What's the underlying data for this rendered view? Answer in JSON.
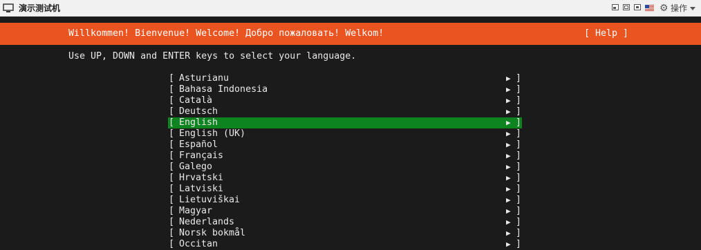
{
  "window": {
    "title": "演示测试机",
    "operations_label": "操作",
    "icons": [
      "monitor-icon",
      "window-mode-icon",
      "window-restore-icon",
      "window-minimize-icon",
      "us-flag-icon",
      "gear-icon",
      "chevron-down-icon"
    ]
  },
  "installer": {
    "header_text": "Willkommen! Bienvenue! Welcome! Добро пожаловать! Welkom!",
    "help_label": "[ Help ]",
    "instruction": "Use UP, DOWN and ENTER keys to select your language.",
    "header_color": "#e95420",
    "selected_color": "#0e8420",
    "languages": [
      {
        "label": "Asturianu",
        "selected": false
      },
      {
        "label": "Bahasa Indonesia",
        "selected": false
      },
      {
        "label": "Català",
        "selected": false
      },
      {
        "label": "Deutsch",
        "selected": false
      },
      {
        "label": "English",
        "selected": true
      },
      {
        "label": "English (UK)",
        "selected": false
      },
      {
        "label": "Español",
        "selected": false
      },
      {
        "label": "Français",
        "selected": false
      },
      {
        "label": "Galego",
        "selected": false
      },
      {
        "label": "Hrvatski",
        "selected": false
      },
      {
        "label": "Latviski",
        "selected": false
      },
      {
        "label": "Lietuviškai",
        "selected": false
      },
      {
        "label": "Magyar",
        "selected": false
      },
      {
        "label": "Nederlands",
        "selected": false
      },
      {
        "label": "Norsk bokmål",
        "selected": false
      },
      {
        "label": "Occitan",
        "selected": false
      }
    ],
    "bracket_open": "[",
    "bracket_close": "]",
    "arrow_glyph": "▶"
  }
}
